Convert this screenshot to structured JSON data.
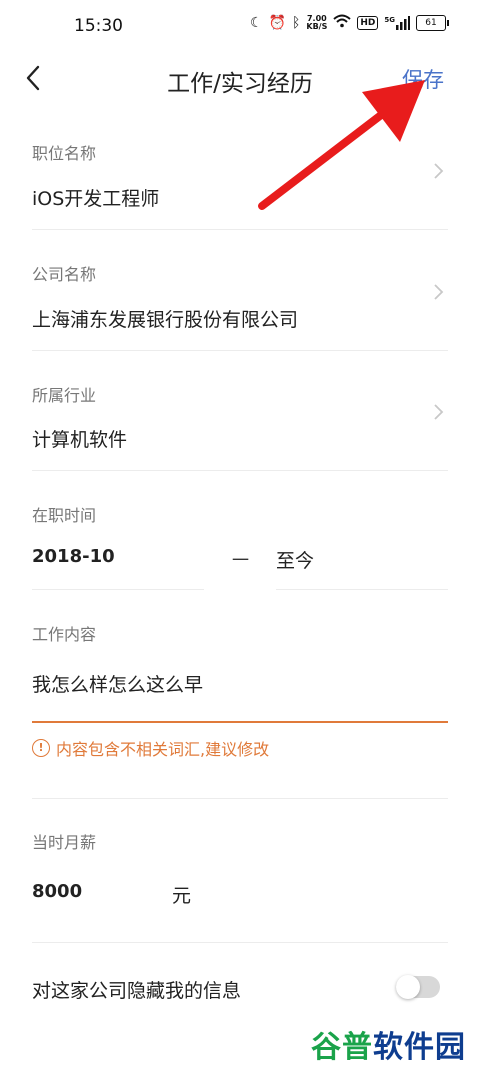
{
  "status_bar": {
    "time": "15:30",
    "net_speed_value": "7.00",
    "net_speed_unit": "KB/S",
    "hd": "HD",
    "signal_label": "5G",
    "battery": "61"
  },
  "nav": {
    "title": "工作/实习经历",
    "save_label": "保存",
    "accent_color": "#4a73c9"
  },
  "form": {
    "position": {
      "label": "职位名称",
      "value": "iOS开发工程师"
    },
    "company": {
      "label": "公司名称",
      "value": "上海浦东发展银行股份有限公司"
    },
    "industry": {
      "label": "所属行业",
      "value": "计算机软件"
    },
    "tenure": {
      "label": "在职时间",
      "start": "2018-10",
      "separator": "一",
      "end": "至今"
    },
    "content": {
      "label": "工作内容",
      "value": "我怎么样怎么这么早",
      "warning": "内容包含不相关词汇,建议修改",
      "warning_color": "#e07a3a"
    },
    "salary": {
      "label": "当时月薪",
      "value": "8000",
      "unit": "元"
    },
    "hide_company": {
      "label": "对这家公司隐藏我的信息",
      "enabled": false
    }
  },
  "watermark": {
    "part_a": "谷普",
    "part_b": "软件园"
  }
}
